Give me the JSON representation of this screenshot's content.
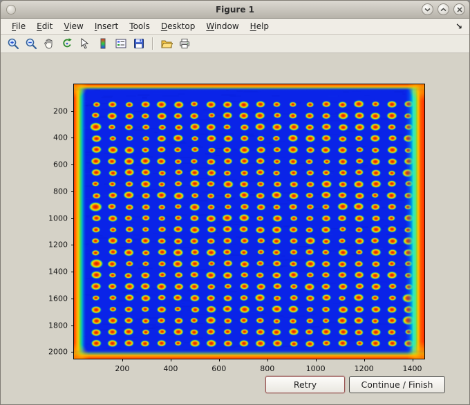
{
  "window": {
    "title": "Figure 1"
  },
  "titlebar": {
    "controls": [
      "window-menu",
      "minimize",
      "maximize",
      "close"
    ]
  },
  "menubar": {
    "items": [
      "File",
      "Edit",
      "View",
      "Insert",
      "Tools",
      "Desktop",
      "Window",
      "Help"
    ],
    "overflow_icon": "↘"
  },
  "toolbar": {
    "icons": [
      "zoom-in",
      "zoom-out",
      "pan",
      "rotate-3d",
      "data-cursor",
      "colorbar",
      "insert-legend",
      "save",
      "open",
      "print"
    ],
    "separator_after_index": 7
  },
  "plot": {
    "description": "Microplate array scan rendered in jet colormap: blue field with grid of red/orange spots, saturated red-orange edges",
    "xticks": [
      200,
      400,
      600,
      800,
      1000,
      1200,
      1400
    ],
    "yticks": [
      200,
      400,
      600,
      800,
      1000,
      1200,
      1400,
      1600,
      1800,
      2000
    ],
    "xlim": [
      0,
      1450
    ],
    "ylim": [
      0,
      2050
    ],
    "grid": {
      "rows": 22,
      "cols": 20
    },
    "colors": {
      "base": "#0a24e8",
      "dot_center": "#c62300",
      "dot_red": "#f43b00",
      "dot_orange": "#ff9d00",
      "dot_yellow": "#ffe000",
      "dot_green": "#7fe030",
      "halo_cyan": "#00becb",
      "edge_red": "#ff2e00",
      "edge_orange": "#ff8a00",
      "edge_yellow": "#ffc400",
      "edge_green": "#4ee04e"
    }
  },
  "buttons": {
    "retry": "Retry",
    "continue": "Continue / Finish"
  }
}
